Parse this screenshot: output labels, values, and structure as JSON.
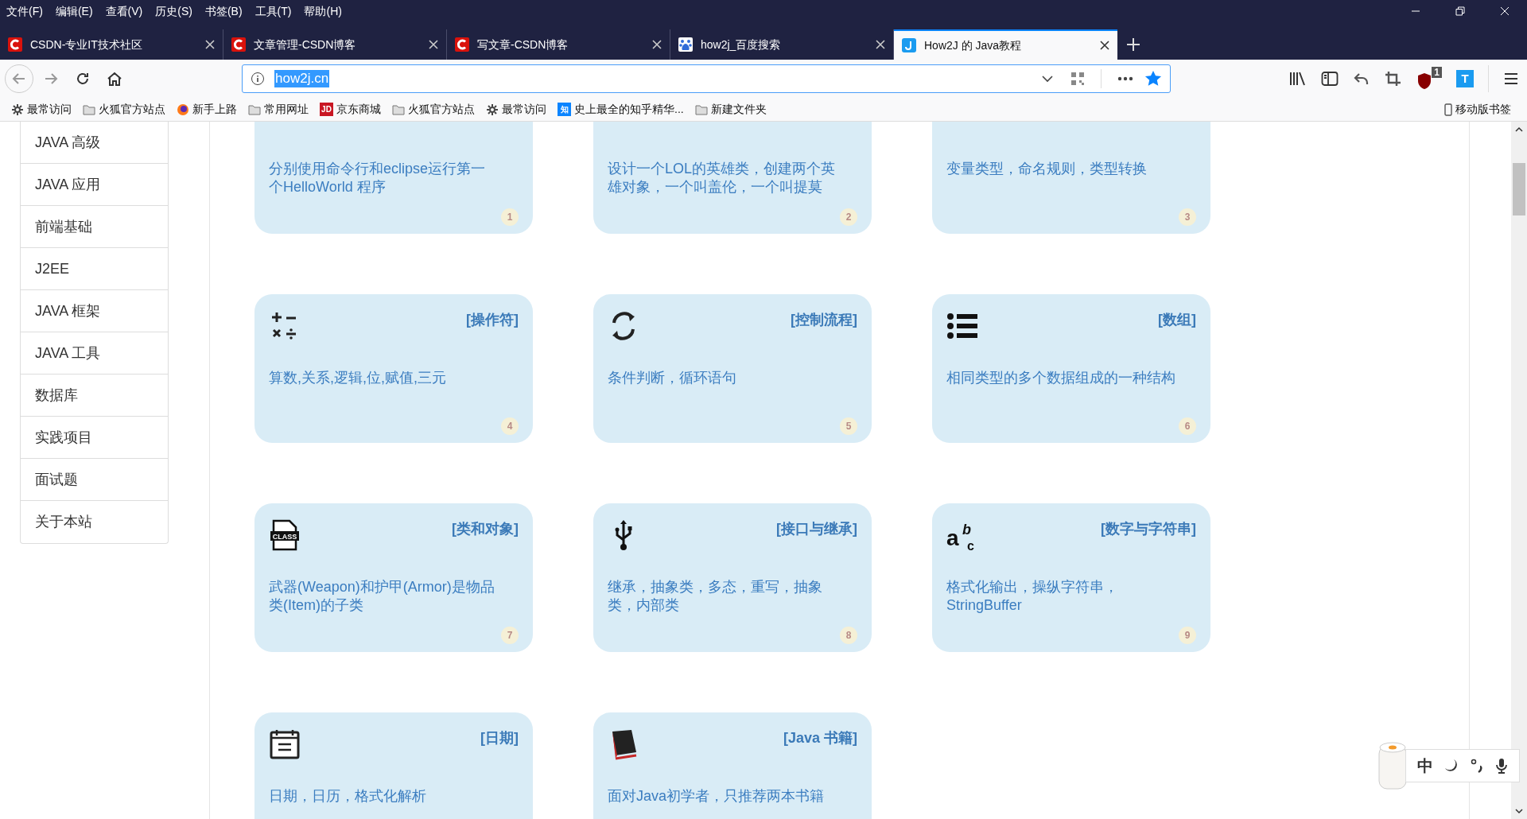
{
  "menu_bar": [
    "文件(F)",
    "编辑(E)",
    "查看(V)",
    "历史(S)",
    "书签(B)",
    "工具(T)",
    "帮助(H)"
  ],
  "tabs": [
    {
      "label": "CSDN-专业IT技术社区",
      "kind": "csdn",
      "selected": false
    },
    {
      "label": "文章管理-CSDN博客",
      "kind": "csdn",
      "selected": false
    },
    {
      "label": "写文章-CSDN博客",
      "kind": "csdn",
      "selected": false
    },
    {
      "label": "how2j_百度搜索",
      "kind": "baidu",
      "selected": false
    },
    {
      "label": "How2J 的 Java教程",
      "kind": "how2j",
      "selected": true
    }
  ],
  "address_bar": {
    "value": "how2j.cn"
  },
  "toolbar": {
    "blocker_count": "1",
    "translate_label": "T"
  },
  "bookmarks": [
    {
      "label": "最常访问",
      "kind": "gear"
    },
    {
      "label": "火狐官方站点",
      "kind": "folder"
    },
    {
      "label": "新手上路",
      "kind": "firefox"
    },
    {
      "label": "常用网址",
      "kind": "folder"
    },
    {
      "label": "京东商城",
      "kind": "logo",
      "logo_text": "JD"
    },
    {
      "label": "火狐官方站点",
      "kind": "folder"
    },
    {
      "label": "最常访问",
      "kind": "gear"
    },
    {
      "label": "史上最全的知乎精华...",
      "kind": "logo",
      "logo_text": "知"
    },
    {
      "label": "新建文件夹",
      "kind": "folder"
    }
  ],
  "mobile_bookmarks": "移动版书签",
  "sidebar": {
    "items": [
      "JAVA 高级",
      "JAVA 应用",
      "前端基础",
      "J2EE",
      "JAVA 框架",
      "JAVA 工具",
      "数据库",
      "实践项目",
      "面试题",
      "关于本站"
    ]
  },
  "cards": [
    {
      "description": "分别使用命令行和eclipse运行第一个HelloWorld 程序",
      "number": "1"
    },
    {
      "description": "设计一个LOL的英雄类，创建两个英雄对象，一个叫盖伦，一个叫提莫",
      "number": "2"
    },
    {
      "description": "变量类型，命名规则，类型转换",
      "number": "3"
    },
    {
      "title": "[操作符]",
      "description": "算数,关系,逻辑,位,赋值,三元",
      "number": "4"
    },
    {
      "title": "[控制流程]",
      "description": "条件判断，循环语句",
      "number": "5"
    },
    {
      "title": "[数组]",
      "description": "相同类型的多个数据组成的一种结构",
      "number": "6"
    },
    {
      "icon_text": "CLASS",
      "title": "[类和对象]",
      "description": "武器(Weapon)和护甲(Armor)是物品类(Item)的子类",
      "number": "7"
    },
    {
      "title": "[接口与继承]",
      "description": "继承，抽象类，多态，重写，抽象类，内部类",
      "number": "8"
    },
    {
      "icon_text": [
        "a",
        "b",
        "c"
      ],
      "title": "[数字与字符串]",
      "description": "格式化输出，操纵字符串，StringBuffer",
      "number": "9"
    },
    {
      "title": "[日期]",
      "description": "日期，日历，格式化解析"
    },
    {
      "title": "[Java 书籍]",
      "description": "面对Java初学者，只推荐两本书籍"
    }
  ],
  "ime": {
    "label": "中"
  }
}
